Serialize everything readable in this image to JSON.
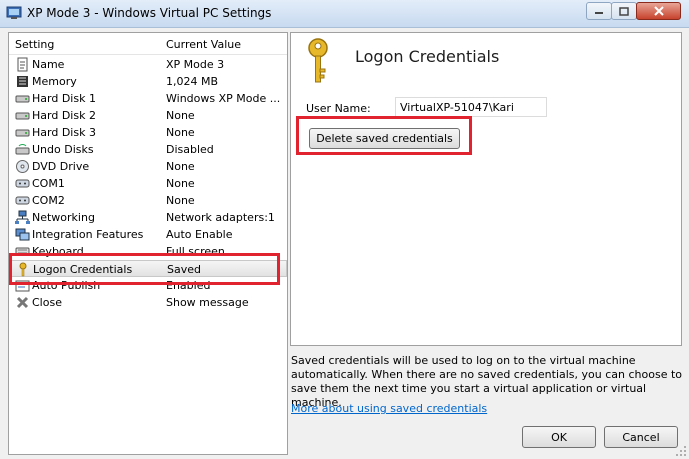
{
  "window": {
    "title": "XP Mode 3 - Windows Virtual PC Settings",
    "icon": "virtual-pc-icon",
    "accent": "#e0232e"
  },
  "settings_list": {
    "col_setting": "Setting",
    "col_value": "Current Value",
    "items": [
      {
        "name": "Name",
        "value": "XP Mode 3",
        "icon": "name-doc-icon"
      },
      {
        "name": "Memory",
        "value": "1,024 MB",
        "icon": "memory-chip-icon"
      },
      {
        "name": "Hard Disk 1",
        "value": "Windows XP Mode ...",
        "icon": "hard-disk-icon"
      },
      {
        "name": "Hard Disk 2",
        "value": "None",
        "icon": "hard-disk-icon"
      },
      {
        "name": "Hard Disk 3",
        "value": "None",
        "icon": "hard-disk-icon"
      },
      {
        "name": "Undo Disks",
        "value": "Disabled",
        "icon": "undo-disk-icon"
      },
      {
        "name": "DVD Drive",
        "value": "None",
        "icon": "dvd-drive-icon"
      },
      {
        "name": "COM1",
        "value": "None",
        "icon": "com-port-icon"
      },
      {
        "name": "COM2",
        "value": "None",
        "icon": "com-port-icon"
      },
      {
        "name": "Networking",
        "value": "Network adapters:1",
        "icon": "network-icon"
      },
      {
        "name": "Integration Features",
        "value": "Auto Enable",
        "icon": "integration-icon"
      },
      {
        "name": "Keyboard",
        "value": "Full screen",
        "icon": "keyboard-icon"
      },
      {
        "name": "Logon Credentials",
        "value": "Saved",
        "icon": "key-icon"
      },
      {
        "name": "Auto Publish",
        "value": "Enabled",
        "icon": "auto-publish-icon"
      },
      {
        "name": "Close",
        "value": "Show message",
        "icon": "close-x-icon"
      }
    ]
  },
  "detail": {
    "title": "Logon Credentials",
    "user_name_label": "User Name:",
    "user_name_value": "VirtualXP-51047\\Kari",
    "delete_button": "Delete saved credentials"
  },
  "footer": {
    "description": "Saved credentials will be used to log on to the virtual machine automatically. When there are no saved credentials, you can choose to save them the next time you start a virtual application or virtual machine.",
    "link": "More about using saved credentials",
    "ok": "OK",
    "cancel": "Cancel"
  }
}
